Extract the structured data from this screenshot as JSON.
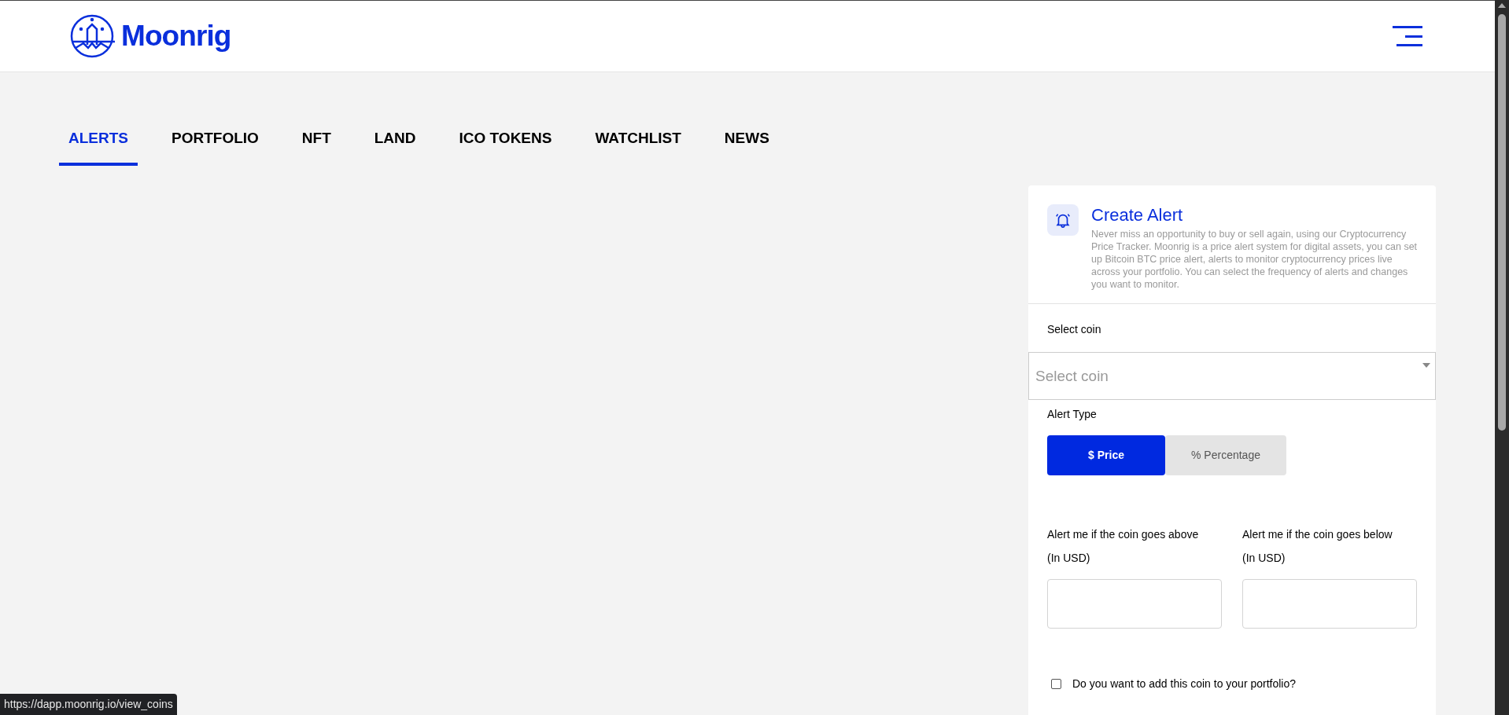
{
  "header": {
    "logo_text": "Moonrig"
  },
  "tabs": [
    {
      "label": "ALERTS",
      "selected": true
    },
    {
      "label": "PORTFOLIO",
      "selected": false
    },
    {
      "label": "NFT",
      "selected": false
    },
    {
      "label": "LAND",
      "selected": false
    },
    {
      "label": "ICO TOKENS",
      "selected": false
    },
    {
      "label": "WATCHLIST",
      "selected": false
    },
    {
      "label": "NEWS",
      "selected": false
    }
  ],
  "create_alert": {
    "title": "Create Alert",
    "description": "Never miss an opportunity to buy or sell again, using our Cryptocurrency Price Tracker. Moonrig is a price alert system for digital assets, you can set up Bitcoin BTC price alert, alerts to monitor cryptocurrency prices live across your portfolio. You can select the frequency of alerts and changes you want to monitor.",
    "coin_label": "Select coin",
    "coin_select": {
      "placeholder": "Select coin"
    },
    "alert_type_label": "Alert Type",
    "alert_types": [
      {
        "label": "$ Price",
        "selected": true
      },
      {
        "label": "% Percentage",
        "selected": false
      }
    ],
    "thresholds": [
      {
        "label": "Alert me if the coin goes above",
        "unit": "(In USD)"
      },
      {
        "label": "Alert me if the coin goes below",
        "unit": "(In USD)"
      }
    ],
    "portfolio_checkbox": {
      "label": "Do you want to add this coin to your portfolio?",
      "checked": false
    }
  },
  "status_url": "https://dapp.moonrig.io/view_coins"
}
